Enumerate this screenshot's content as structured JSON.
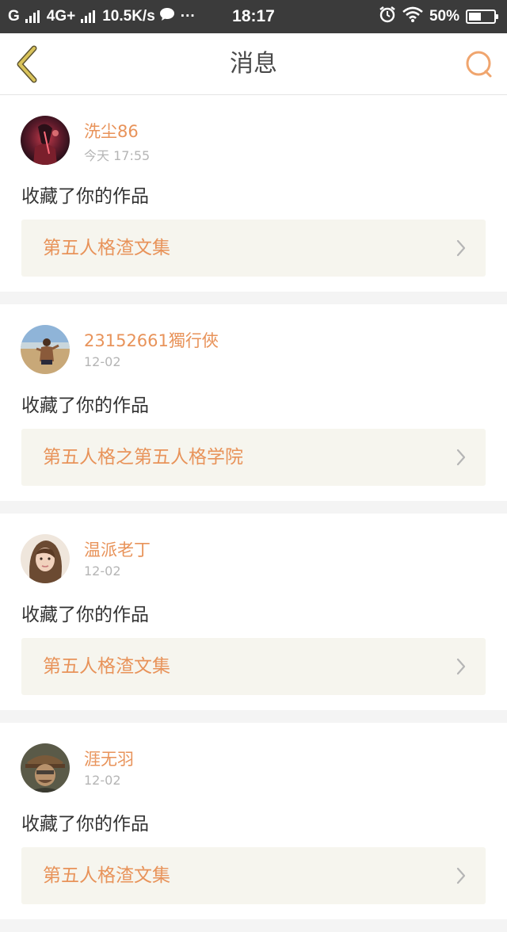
{
  "status_bar": {
    "carrier": "G",
    "network": "4G+",
    "speed": "10.5K/s",
    "more": "···",
    "time": "18:17",
    "battery": "50%",
    "battery_level": 0.5,
    "icons": [
      "signal-icon",
      "chat-bubble-icon",
      "alarm-icon",
      "wifi-icon",
      "battery-icon"
    ]
  },
  "header": {
    "title": "消息",
    "back_icon": "chevron-left-icon",
    "search_icon": "search-icon"
  },
  "colors": {
    "accent": "#e8935a",
    "back_arrow": "#d9c35a",
    "text_primary": "#333333",
    "text_muted": "#b5b5b5",
    "work_bg": "#f6f5ee"
  },
  "messages": [
    {
      "username": "洗尘86",
      "time": "今天 17:55",
      "action": "收藏了你的作品",
      "work": "第五人格渣文集"
    },
    {
      "username": "23152661獨行俠",
      "time": "12-02",
      "action": "收藏了你的作品",
      "work": "第五人格之第五人格学院"
    },
    {
      "username": "温派老丁",
      "time": "12-02",
      "action": "收藏了你的作品",
      "work": "第五人格渣文集"
    },
    {
      "username": "涯无羽",
      "time": "12-02",
      "action": "收藏了你的作品",
      "work": "第五人格渣文集"
    }
  ]
}
